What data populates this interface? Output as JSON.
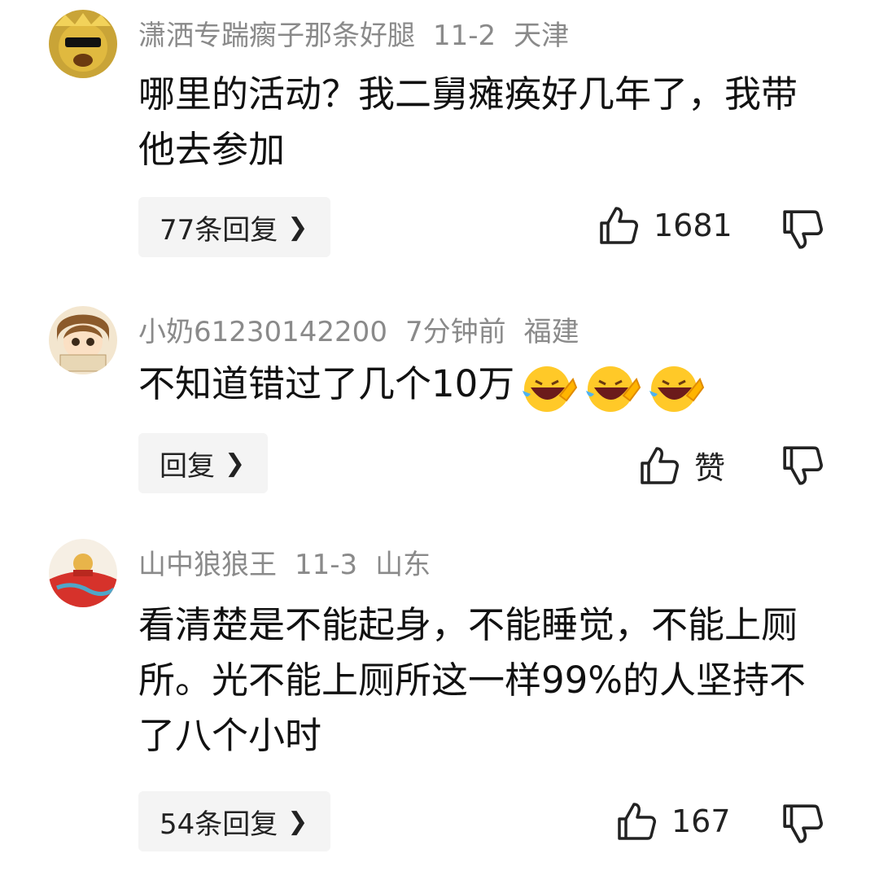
{
  "comments": [
    {
      "username": "潇洒专踹瘸子那条好腿",
      "date": "11-2",
      "location": "天津",
      "text": "哪里的活动？我二舅瘫痪好几年了，我带他去参加",
      "reply_label": "77条回复",
      "likes": "1681",
      "avatar_icon": "gold-mask-avatar"
    },
    {
      "username": "小奶61230142200",
      "date": "7分钟前",
      "location": "福建",
      "text": "不知道错过了几个10万",
      "emojis": [
        "laughing-crying-emoji",
        "laughing-crying-emoji",
        "laughing-crying-emoji"
      ],
      "reply_label": "回复",
      "likes": "赞",
      "avatar_icon": "cartoon-girl-avatar"
    },
    {
      "username": "山中狼狼王",
      "date": "11-3",
      "location": "山东",
      "text": "看清楚是不能起身，不能睡觉，不能上厕所。光不能上厕所这一样99%的人坚持不了八个小时",
      "reply_label": "54条回复",
      "likes": "167",
      "avatar_icon": "red-illustration-avatar"
    }
  ],
  "colors": {
    "meta_gray": "#8a8a8a",
    "pill_bg": "#f4f4f4",
    "text": "#111111"
  }
}
